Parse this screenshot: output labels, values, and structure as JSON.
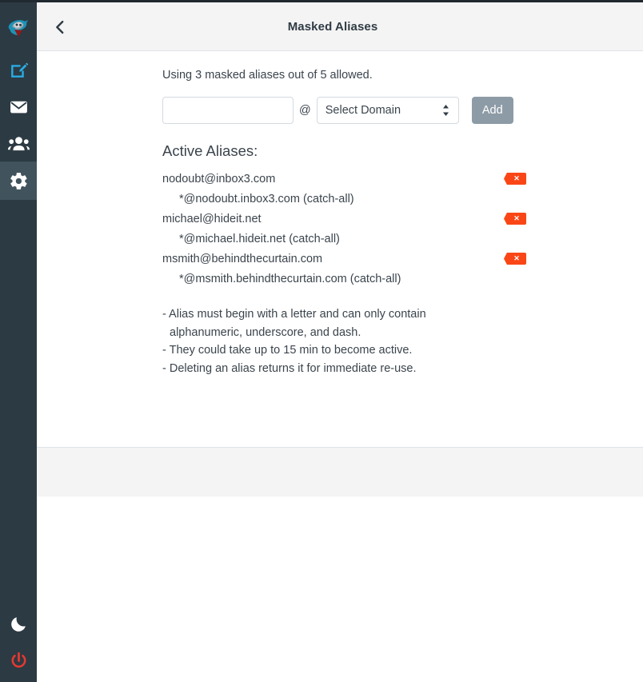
{
  "sidebar": {
    "items": [
      {
        "name": "logo",
        "icon": "spy-logo-icon",
        "label": "HideIt logo",
        "active": false
      },
      {
        "name": "compose",
        "icon": "compose-pencil-icon",
        "label": "Compose",
        "active": false
      },
      {
        "name": "mail",
        "icon": "envelope-icon",
        "label": "Mail",
        "active": false
      },
      {
        "name": "contacts",
        "icon": "people-icon",
        "label": "Contacts",
        "active": false
      },
      {
        "name": "settings",
        "icon": "gear-icon",
        "label": "Settings",
        "active": true
      }
    ],
    "bottom_items": [
      {
        "name": "dark-mode",
        "icon": "moon-icon",
        "label": "Dark mode"
      },
      {
        "name": "logout",
        "icon": "power-icon",
        "label": "Log out"
      }
    ]
  },
  "header": {
    "back_icon": "chevron-left-icon",
    "title": "Masked Aliases"
  },
  "quota": {
    "text": "Using 3 masked aliases out of 5 allowed.",
    "used": 3,
    "allowed": 5
  },
  "add_form": {
    "alias_value": "",
    "alias_placeholder": "",
    "at_symbol": "@",
    "domain_selected": "Select Domain",
    "domain_options": [
      "Select Domain"
    ],
    "select_icon": "updown-arrows-icon",
    "add_label": "Add"
  },
  "aliases_section": {
    "title": "Active Aliases:",
    "delete_icon": "delete-x-icon",
    "delete_glyph": "✕",
    "items": [
      {
        "address": "nodoubt@inbox3.com",
        "catch_all": "*@nodoubt.inbox3.com (catch-all)"
      },
      {
        "address": "michael@hideit.net",
        "catch_all": "*@michael.hideit.net (catch-all)"
      },
      {
        "address": "msmith@behindthecurtain.com",
        "catch_all": "*@msmith.behindthecurtain.com (catch-all)"
      }
    ]
  },
  "notes": {
    "line1": "- Alias must begin with a letter and can only contain",
    "line2": "alphanumeric, underscore, and dash.",
    "line3": "- They could take up to 15 min to become active.",
    "line4": "- Deleting an alias returns it for immediate re-use."
  },
  "colors": {
    "sidebar_bg": "#2c3a43",
    "sidebar_active": "#41535c",
    "accent_blue": "#29abe2",
    "delete_orange": "#fa4616",
    "add_button": "#8d9ba6",
    "power_red": "#e8392f",
    "header_bg": "#f4f4f4",
    "text": "#3b444c"
  }
}
